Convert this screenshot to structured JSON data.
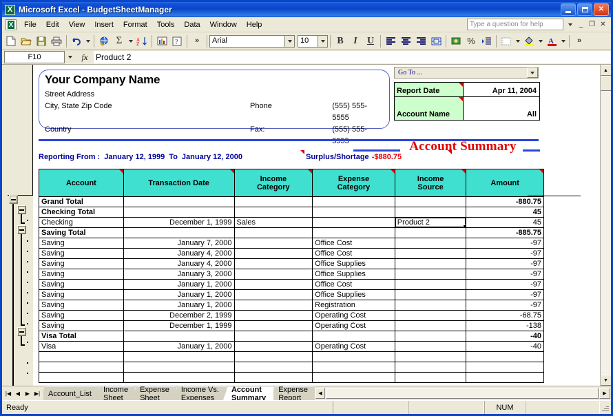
{
  "window": {
    "app_name": "Microsoft Excel",
    "document_name": "BudgetSheetManager",
    "title": "Microsoft Excel - BudgetSheetManager",
    "logo_glyph": "X",
    "minimize": "_",
    "maximize": "□",
    "close": "✕"
  },
  "menu": {
    "items": [
      "File",
      "Edit",
      "View",
      "Insert",
      "Format",
      "Tools",
      "Data",
      "Window",
      "Help"
    ],
    "ask_placeholder": "Type a question for help",
    "doc_minimize": "_",
    "doc_restore": "❐",
    "doc_close": "✕"
  },
  "toolbar": {
    "buttons": [
      {
        "name": "new-file-icon",
        "glyph": "🗋"
      },
      {
        "name": "open-file-icon",
        "glyph": "📂"
      },
      {
        "name": "save-icon",
        "glyph": "💾"
      },
      {
        "name": "print-icon",
        "glyph": "🖨"
      },
      {
        "name": "undo-icon",
        "glyph": "↶"
      },
      {
        "name": "insert-hyperlink-icon",
        "glyph": "🌐"
      },
      {
        "name": "autosum-icon",
        "glyph": "Σ"
      },
      {
        "name": "sort-ascending-icon",
        "glyph": "A↓"
      },
      {
        "name": "chart-wizard-icon",
        "glyph": "📊"
      },
      {
        "name": "help-icon",
        "glyph": "?"
      },
      {
        "name": "toolbar-overflow-icon",
        "glyph": "»"
      }
    ],
    "font_name": "Arial",
    "font_size": "10",
    "bold_label": "B",
    "italic_label": "I",
    "underline_label": "U",
    "merge_label": "a",
    "currency_label": "$",
    "percent_label": "%",
    "indent_label": "⇥",
    "overflow_label": "»"
  },
  "formula_bar": {
    "name_box": "F10",
    "fx_label": "fx",
    "value": "Product 2"
  },
  "goto": {
    "label": "Go To ...",
    "arrow": "▼"
  },
  "company": {
    "name": "Your Company Name",
    "street": "Street Address",
    "city": "City, State Zip Code",
    "country": "Country",
    "phone_label": "Phone",
    "phone_value": "(555) 555-5555",
    "fax_label": "Fax:",
    "fax_value": "(555) 555-5555"
  },
  "report_info": {
    "date_label": "Report Date",
    "date_value": "Apr 11, 2004",
    "account_label": "Account Name",
    "account_value": "All"
  },
  "report_meta": {
    "title": "Account Summary",
    "reporting_from_label": "Reporting From :",
    "from_date": "January 12, 1999",
    "to_label": "To",
    "to_date": "January 12, 2000",
    "surplus_label": "Surplus/Shortage",
    "surplus_value": "-$880.75"
  },
  "table": {
    "columns": [
      "Account",
      "Transaction Date",
      "Income\nCategory",
      "Expense\nCategory",
      "Income\nSource",
      "Amount"
    ],
    "columns_line1": [
      "Account",
      "Transaction Date",
      "Income",
      "Expense",
      "Income",
      "Amount"
    ],
    "columns_line2": [
      "",
      "",
      "Category",
      "Category",
      "Source",
      ""
    ],
    "rows": [
      {
        "account": "Grand Total",
        "date": "",
        "income_category": "",
        "expense_category": "",
        "income_source": "",
        "amount": "-880.75",
        "total": true
      },
      {
        "account": "Checking Total",
        "date": "",
        "income_category": "",
        "expense_category": "",
        "income_source": "",
        "amount": "45",
        "total": true
      },
      {
        "account": "Checking",
        "date": "December 1, 1999",
        "income_category": "Sales",
        "expense_category": "",
        "income_source": "Product 2",
        "amount": "45",
        "total": false,
        "selected": true
      },
      {
        "account": "Saving Total",
        "date": "",
        "income_category": "",
        "expense_category": "",
        "income_source": "",
        "amount": "-885.75",
        "total": true
      },
      {
        "account": "Saving",
        "date": "January 7, 2000",
        "income_category": "",
        "expense_category": "Office Cost",
        "income_source": "",
        "amount": "-97",
        "total": false
      },
      {
        "account": "Saving",
        "date": "January 4, 2000",
        "income_category": "",
        "expense_category": "Office Cost",
        "income_source": "",
        "amount": "-97",
        "total": false
      },
      {
        "account": "Saving",
        "date": "January 4, 2000",
        "income_category": "",
        "expense_category": "Office Supplies",
        "income_source": "",
        "amount": "-97",
        "total": false
      },
      {
        "account": "Saving",
        "date": "January 3, 2000",
        "income_category": "",
        "expense_category": "Office Supplies",
        "income_source": "",
        "amount": "-97",
        "total": false
      },
      {
        "account": "Saving",
        "date": "January 1, 2000",
        "income_category": "",
        "expense_category": "Office Cost",
        "income_source": "",
        "amount": "-97",
        "total": false
      },
      {
        "account": "Saving",
        "date": "January 1, 2000",
        "income_category": "",
        "expense_category": "Office Supplies",
        "income_source": "",
        "amount": "-97",
        "total": false
      },
      {
        "account": "Saving",
        "date": "January 1, 2000",
        "income_category": "",
        "expense_category": "Registration",
        "income_source": "",
        "amount": "-97",
        "total": false
      },
      {
        "account": "Saving",
        "date": "December 2, 1999",
        "income_category": "",
        "expense_category": "Operating Cost",
        "income_source": "",
        "amount": "-68.75",
        "total": false
      },
      {
        "account": "Saving",
        "date": "December 1, 1999",
        "income_category": "",
        "expense_category": "Operating Cost",
        "income_source": "",
        "amount": "-138",
        "total": false
      },
      {
        "account": "Visa Total",
        "date": "",
        "income_category": "",
        "expense_category": "",
        "income_source": "",
        "amount": "-40",
        "total": true
      },
      {
        "account": "Visa",
        "date": "January 1, 2000",
        "income_category": "",
        "expense_category": "Operating Cost",
        "income_source": "",
        "amount": "-40",
        "total": false
      },
      {
        "account": "",
        "date": "",
        "income_category": "",
        "expense_category": "",
        "income_source": "",
        "amount": "",
        "total": false
      },
      {
        "account": "",
        "date": "",
        "income_category": "",
        "expense_category": "",
        "income_source": "",
        "amount": "",
        "total": false
      },
      {
        "account": "",
        "date": "",
        "income_category": "",
        "expense_category": "",
        "income_source": "",
        "amount": "",
        "total": false
      }
    ]
  },
  "sheet_tabs": {
    "first_glyph": "|◀",
    "prev_glyph": "◀",
    "next_glyph": "▶",
    "last_glyph": "▶|",
    "items": [
      {
        "label": "Account_List",
        "active": false
      },
      {
        "label": "Income Sheet",
        "active": false
      },
      {
        "label": "Expense Sheet",
        "active": false
      },
      {
        "label": "Income Vs. Expenses",
        "active": false
      },
      {
        "label": "Account Summary",
        "active": true
      },
      {
        "label": "Expense Report",
        "active": false
      }
    ],
    "scroll_left": "◀",
    "scroll_right": "▶"
  },
  "status_bar": {
    "message": "Ready",
    "num_lock": "NUM"
  },
  "scrollbar": {
    "up_glyph": "▲",
    "down_glyph": "▼"
  },
  "colors": {
    "title_blue": "#0a46c8",
    "header_turquoise": "#40e0d0",
    "info_green": "#ccffcc",
    "accent_red": "#e00000",
    "accent_blue": "#00009a",
    "rule_blue": "#2b45d8",
    "chrome": "#ece9d8"
  }
}
